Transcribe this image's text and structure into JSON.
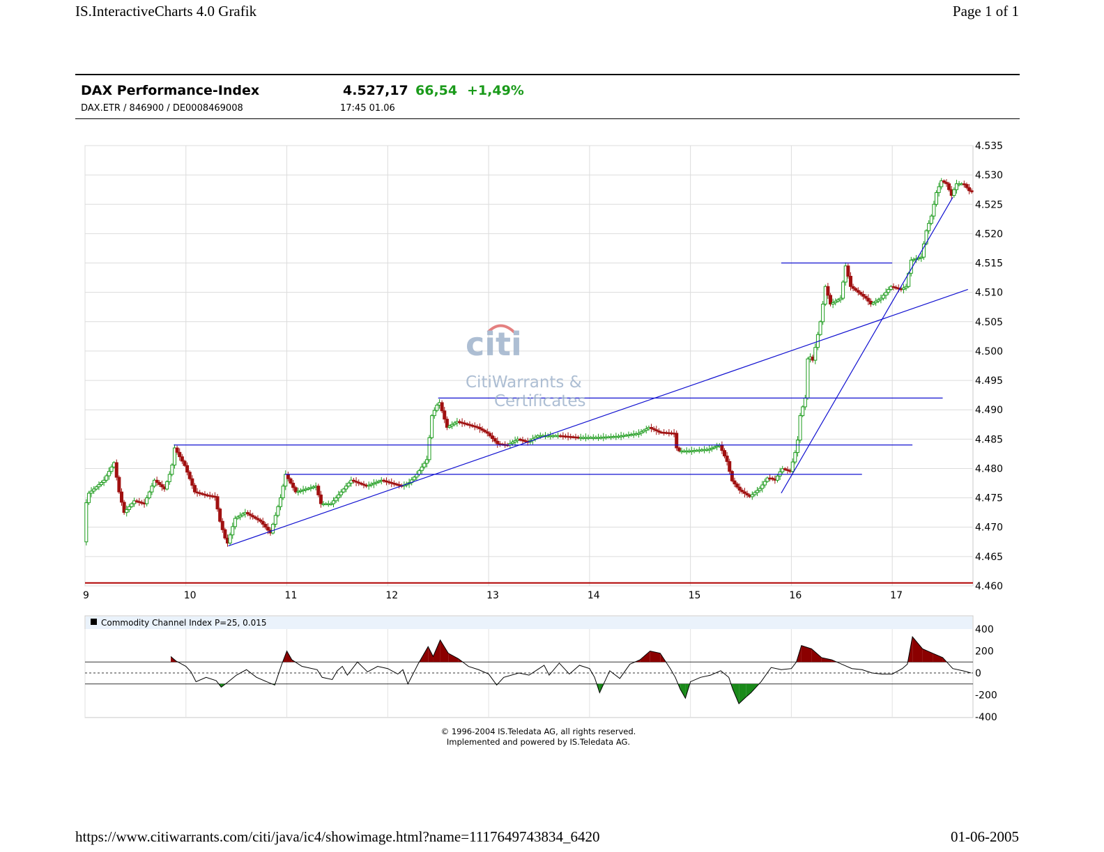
{
  "browser": {
    "header_title": "IS.InteractiveCharts 4.0 Grafik",
    "page_label": "Page 1 of 1",
    "footer_url": "https://www.citiwarrants.com/citi/java/ic4/showimage.html?name=1117649743834_6420",
    "footer_date": "01-06-2005"
  },
  "quote": {
    "name": "DAX Performance-Index",
    "identifiers": "DAX.ETR  /  846900  /  DE0008469008",
    "last": "4.527,17",
    "change": "66,54",
    "change_pct": "+1,49%",
    "time": "17:45  01.06",
    "colors": {
      "up": "#1a9a1a"
    }
  },
  "watermark": {
    "logo": "citi",
    "line1": "CitiWarrants &",
    "line2": "Certificates",
    "color": "#9fb3cc",
    "arc_color": "#e06a6a"
  },
  "copyright": {
    "line1": "© 1996-2004 IS.Teledata AG, all rights reserved.",
    "line2": "Implemented and powered by IS.Teledata AG."
  },
  "chart_data": [
    {
      "type": "candlestick",
      "ylim": [
        4460,
        4535
      ],
      "ytick_labels": [
        "4.535",
        "4.530",
        "4.525",
        "4.520",
        "4.515",
        "4.510",
        "4.505",
        "4.500",
        "4.495",
        "4.490",
        "4.485",
        "4.480",
        "4.475",
        "4.470",
        "4.465",
        "4.460"
      ],
      "xtick_labels": [
        "9",
        "10",
        "11",
        "12",
        "13",
        "14",
        "15",
        "16",
        "17"
      ],
      "xlim": [
        9,
        17.8
      ],
      "grid": true,
      "colors": {
        "up": "#1a9a1a",
        "down": "#a01010",
        "trendline": "#1010d0",
        "baseline": "#b00000"
      },
      "price_path": [
        [
          9.0,
          4467.5
        ],
        [
          9.03,
          4475.5
        ],
        [
          9.1,
          4476.5
        ],
        [
          9.2,
          4478
        ],
        [
          9.3,
          4481
        ],
        [
          9.35,
          4476
        ],
        [
          9.4,
          4472.5
        ],
        [
          9.5,
          4474.5
        ],
        [
          9.6,
          4474
        ],
        [
          9.7,
          4478
        ],
        [
          9.8,
          4476.5
        ],
        [
          9.87,
          4480
        ],
        [
          9.9,
          4483.5
        ],
        [
          10.0,
          4480.5
        ],
        [
          10.1,
          4476
        ],
        [
          10.2,
          4475.5
        ],
        [
          10.3,
          4475.2
        ],
        [
          10.35,
          4471
        ],
        [
          10.42,
          4467
        ],
        [
          10.5,
          4471.5
        ],
        [
          10.6,
          4472.5
        ],
        [
          10.75,
          4471
        ],
        [
          10.85,
          4469
        ],
        [
          10.95,
          4475
        ],
        [
          11.0,
          4479
        ],
        [
          11.1,
          4476
        ],
        [
          11.3,
          4477
        ],
        [
          11.35,
          4474
        ],
        [
          11.45,
          4474
        ],
        [
          11.55,
          4476
        ],
        [
          11.65,
          4478
        ],
        [
          11.8,
          4477
        ],
        [
          11.95,
          4478
        ],
        [
          12.05,
          4477.5
        ],
        [
          12.15,
          4477
        ],
        [
          12.22,
          4477.5
        ],
        [
          12.3,
          4479
        ],
        [
          12.4,
          4481.5
        ],
        [
          12.45,
          4489
        ],
        [
          12.52,
          4491.5
        ],
        [
          12.6,
          4487
        ],
        [
          12.7,
          4488
        ],
        [
          12.8,
          4487.5
        ],
        [
          12.9,
          4487
        ],
        [
          13.0,
          4486
        ],
        [
          13.1,
          4484.2
        ],
        [
          13.2,
          4484
        ],
        [
          13.3,
          4485
        ],
        [
          13.4,
          4484.5
        ],
        [
          13.5,
          4485.6
        ],
        [
          13.7,
          4485.6
        ],
        [
          13.9,
          4485.3
        ],
        [
          14.1,
          4485.3
        ],
        [
          14.3,
          4485.5
        ],
        [
          14.5,
          4486
        ],
        [
          14.6,
          4487
        ],
        [
          14.7,
          4486.2
        ],
        [
          14.85,
          4486
        ],
        [
          14.88,
          4483
        ],
        [
          15.0,
          4483
        ],
        [
          15.2,
          4483.3
        ],
        [
          15.3,
          4484
        ],
        [
          15.38,
          4481
        ],
        [
          15.42,
          4478
        ],
        [
          15.5,
          4476.3
        ],
        [
          15.6,
          4475.2
        ],
        [
          15.7,
          4476.6
        ],
        [
          15.78,
          4478.5
        ],
        [
          15.85,
          4478
        ],
        [
          15.92,
          4480
        ],
        [
          16.0,
          4479.5
        ],
        [
          16.07,
          4484
        ],
        [
          16.1,
          4489
        ],
        [
          16.15,
          4492
        ],
        [
          16.18,
          4500
        ],
        [
          16.22,
          4498
        ],
        [
          16.3,
          4505
        ],
        [
          16.35,
          4511
        ],
        [
          16.4,
          4508
        ],
        [
          16.5,
          4509
        ],
        [
          16.55,
          4514.5
        ],
        [
          16.6,
          4511
        ],
        [
          16.75,
          4509
        ],
        [
          16.8,
          4508
        ],
        [
          16.9,
          4509
        ],
        [
          17.0,
          4511
        ],
        [
          17.1,
          4510.5
        ],
        [
          17.15,
          4511
        ],
        [
          17.2,
          4515.5
        ],
        [
          17.3,
          4516
        ],
        [
          17.35,
          4520.5
        ],
        [
          17.4,
          4523
        ],
        [
          17.45,
          4527
        ],
        [
          17.5,
          4529
        ],
        [
          17.55,
          4528.5
        ],
        [
          17.6,
          4526.5
        ],
        [
          17.65,
          4528.5
        ],
        [
          17.72,
          4528.5
        ],
        [
          17.78,
          4527.2
        ]
      ],
      "trendlines": [
        [
          [
            10.42,
            4466.8
          ],
          [
            17.75,
            4510.5
          ]
        ],
        [
          [
            15.9,
            4475.8
          ],
          [
            17.6,
            4526.2
          ]
        ],
        [
          [
            9.88,
            4484
          ],
          [
            17.2,
            4484
          ]
        ],
        [
          [
            10.98,
            4479
          ],
          [
            16.7,
            4479
          ]
        ],
        [
          [
            12.5,
            4492
          ],
          [
            17.5,
            4492
          ]
        ],
        [
          [
            15.9,
            4515
          ],
          [
            17.0,
            4515
          ]
        ]
      ],
      "baseline": 4460.5
    },
    {
      "type": "line",
      "title": "Commodity Channel Index P=25, 0.015",
      "ylim": [
        -400,
        400
      ],
      "ytick_labels": [
        "400",
        "200",
        "0",
        "-200",
        "-400"
      ],
      "reference_lines": [
        100,
        0,
        -100
      ],
      "colors": {
        "line": "#000000",
        "above": "#8b0000",
        "below": "#1a8a1a"
      },
      "values": [
        [
          9.85,
          150
        ],
        [
          9.9,
          110
        ],
        [
          10.0,
          60
        ],
        [
          10.05,
          10
        ],
        [
          10.1,
          -80
        ],
        [
          10.2,
          -40
        ],
        [
          10.3,
          -70
        ],
        [
          10.35,
          -130
        ],
        [
          10.42,
          -80
        ],
        [
          10.5,
          -20
        ],
        [
          10.6,
          30
        ],
        [
          10.7,
          -40
        ],
        [
          10.8,
          -80
        ],
        [
          10.88,
          -110
        ],
        [
          10.95,
          80
        ],
        [
          11.0,
          200
        ],
        [
          11.05,
          120
        ],
        [
          11.15,
          60
        ],
        [
          11.3,
          30
        ],
        [
          11.35,
          -40
        ],
        [
          11.45,
          -60
        ],
        [
          11.5,
          20
        ],
        [
          11.55,
          60
        ],
        [
          11.6,
          -20
        ],
        [
          11.7,
          100
        ],
        [
          11.8,
          10
        ],
        [
          11.9,
          60
        ],
        [
          12.0,
          40
        ],
        [
          12.1,
          -10
        ],
        [
          12.15,
          30
        ],
        [
          12.2,
          -100
        ],
        [
          12.3,
          80
        ],
        [
          12.4,
          240
        ],
        [
          12.45,
          150
        ],
        [
          12.52,
          300
        ],
        [
          12.6,
          180
        ],
        [
          12.7,
          130
        ],
        [
          12.8,
          60
        ],
        [
          12.9,
          30
        ],
        [
          13.0,
          -10
        ],
        [
          13.08,
          -110
        ],
        [
          13.15,
          -40
        ],
        [
          13.3,
          0
        ],
        [
          13.4,
          -20
        ],
        [
          13.5,
          40
        ],
        [
          13.55,
          70
        ],
        [
          13.6,
          -20
        ],
        [
          13.7,
          90
        ],
        [
          13.8,
          -10
        ],
        [
          13.9,
          70
        ],
        [
          14.0,
          40
        ],
        [
          14.05,
          -40
        ],
        [
          14.1,
          -180
        ],
        [
          14.2,
          20
        ],
        [
          14.3,
          -50
        ],
        [
          14.4,
          80
        ],
        [
          14.5,
          120
        ],
        [
          14.6,
          200
        ],
        [
          14.7,
          180
        ],
        [
          14.8,
          40
        ],
        [
          14.85,
          -40
        ],
        [
          14.9,
          -150
        ],
        [
          14.95,
          -230
        ],
        [
          15.0,
          -80
        ],
        [
          15.1,
          -40
        ],
        [
          15.2,
          -20
        ],
        [
          15.3,
          20
        ],
        [
          15.38,
          -40
        ],
        [
          15.42,
          -150
        ],
        [
          15.48,
          -280
        ],
        [
          15.55,
          -220
        ],
        [
          15.6,
          -180
        ],
        [
          15.7,
          -80
        ],
        [
          15.8,
          50
        ],
        [
          15.9,
          30
        ],
        [
          16.0,
          40
        ],
        [
          16.05,
          100
        ],
        [
          16.1,
          250
        ],
        [
          16.2,
          220
        ],
        [
          16.3,
          140
        ],
        [
          16.4,
          120
        ],
        [
          16.5,
          80
        ],
        [
          16.6,
          40
        ],
        [
          16.7,
          30
        ],
        [
          16.8,
          0
        ],
        [
          16.9,
          -10
        ],
        [
          17.0,
          -10
        ],
        [
          17.1,
          40
        ],
        [
          17.15,
          80
        ],
        [
          17.2,
          330
        ],
        [
          17.3,
          220
        ],
        [
          17.4,
          180
        ],
        [
          17.5,
          140
        ],
        [
          17.55,
          90
        ],
        [
          17.6,
          40
        ],
        [
          17.7,
          20
        ],
        [
          17.78,
          0
        ]
      ]
    }
  ]
}
